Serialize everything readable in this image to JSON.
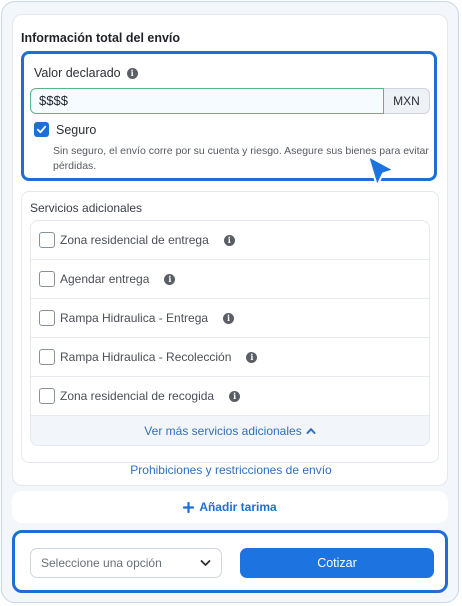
{
  "shipping_info": {
    "title": "Información total del envío",
    "declared_value_label": "Valor declarado",
    "declared_value_input": "$$$$",
    "currency": "MXN",
    "insurance_label": "Seguro",
    "insurance_checked": true,
    "insurance_help": "Sin seguro, el envío corre por su cuenta y riesgo. Asegure sus bienes para evitar pérdidas."
  },
  "additional_services": {
    "title": "Servicios adicionales",
    "items": [
      {
        "label": "Zona residencial de entrega"
      },
      {
        "label": "Agendar entrega"
      },
      {
        "label": "Rampa Hidraulica - Entrega"
      },
      {
        "label": "Rampa Hidraulica - Recolección"
      },
      {
        "label": "Zona residencial de recogida"
      }
    ],
    "more_label": "Ver más servicios adicionales"
  },
  "restrictions_link": "Prohibiciones y restricciones de envío",
  "add_pallet_label": "Añadir tarima",
  "footer": {
    "select_placeholder": "Seleccione una opción",
    "quote_button": "Cotizar"
  },
  "colors": {
    "accent": "#1d6fd6",
    "link": "#2f6fc2"
  }
}
